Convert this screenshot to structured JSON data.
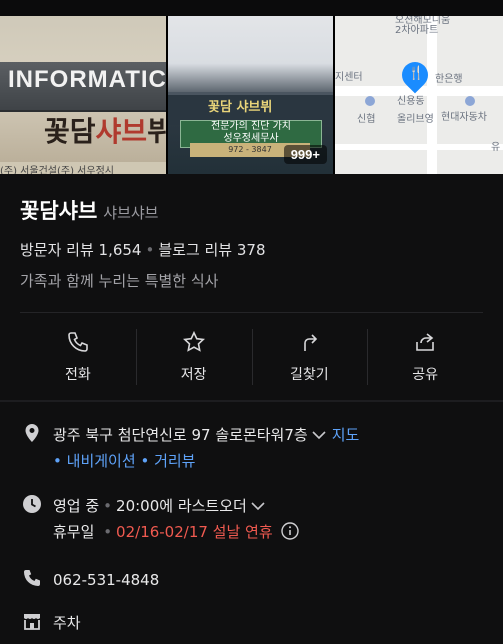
{
  "photos": {
    "sign_text": "INFORMATIC",
    "sign_logo_a": "꽃담",
    "sign_logo_b": "샤브",
    "sign_logo_c": "뷔",
    "sign_sub": "(주) 서울건설(주) 서우정시",
    "building_sign": "꽃담 샤브뷔",
    "building_banner": "전문가의 진단 가치",
    "building_banner2": "성우정세무사",
    "building_phone": "972 - 3847",
    "count": "999+",
    "map_labels": {
      "apt": "오션해모니움\n2차아파트",
      "center": "지센터",
      "bank": "한은행",
      "station": "신용동",
      "olive": "올리브영",
      "shinhan": "신협",
      "hyundai": "현대자동차",
      "yu": "유"
    }
  },
  "place": {
    "name": "꽃담샤브",
    "category": "샤브샤브",
    "visitor_review": "방문자 리뷰 1,654",
    "blog_review": "블로그 리뷰 378",
    "description": "가족과 함께 누리는 특별한 식사"
  },
  "actions": [
    {
      "label": "전화",
      "icon": "phone-icon"
    },
    {
      "label": "저장",
      "icon": "star-icon"
    },
    {
      "label": "길찾기",
      "icon": "directions-icon"
    },
    {
      "label": "공유",
      "icon": "share-icon"
    }
  ],
  "address": {
    "text": "광주 북구 첨단연신로 97 솔로몬타워7층",
    "map_link": "지도",
    "navi_link": "내비게이션",
    "distance_link": "거리뷰"
  },
  "hours": {
    "status": "영업 중",
    "last_order": "20:00에 라스트오더",
    "holiday_label": "휴무일",
    "holiday_value": "02/16-02/17 설날 연휴"
  },
  "phone": "062-531-4848",
  "parking": "주차",
  "colors": {
    "link": "#5ea2f8",
    "alert": "#f05a50",
    "pin": "#1a8cff",
    "bg": "#0f0f10"
  }
}
